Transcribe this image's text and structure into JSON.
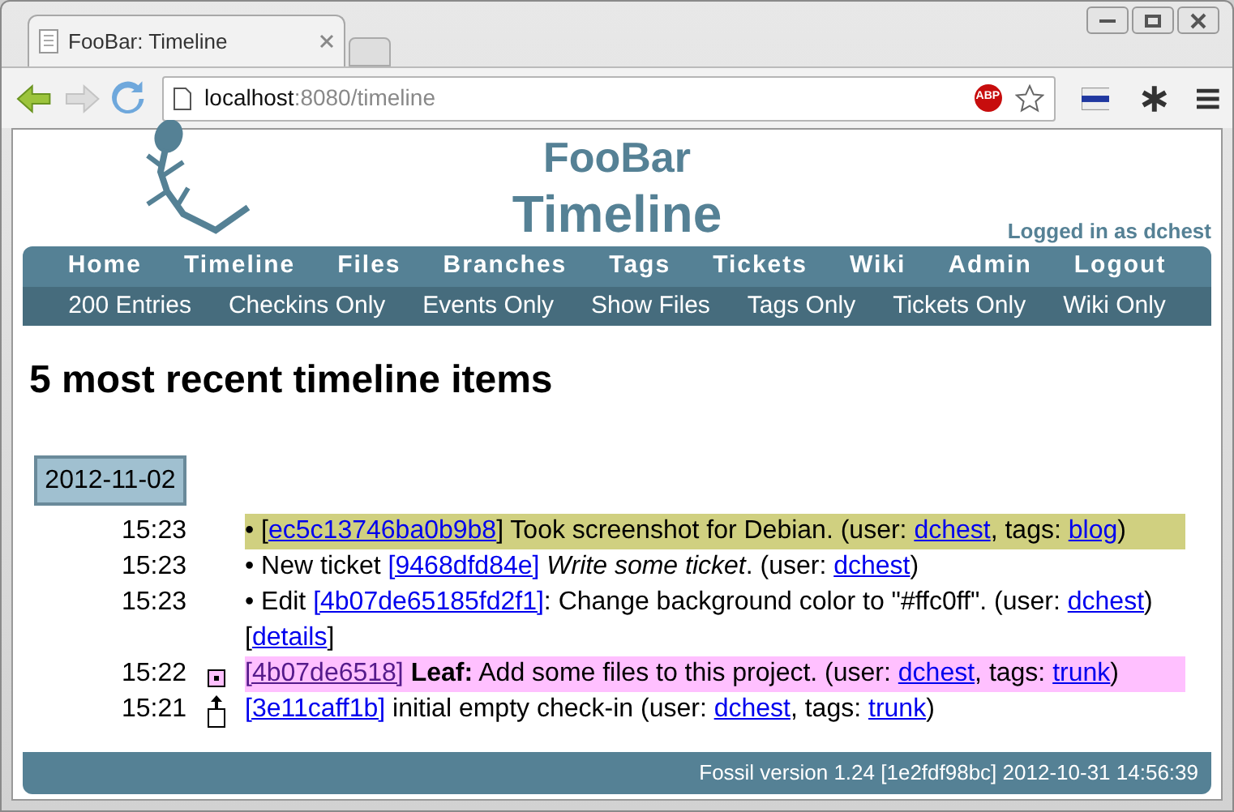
{
  "browser": {
    "tab_title": "FooBar: Timeline",
    "url_host": "localhost",
    "url_rest": ":8080/timeline",
    "adblock": "ABP"
  },
  "header": {
    "project": "FooBar",
    "page_title": "Timeline",
    "login": "Logged in as dchest"
  },
  "main_menu": [
    "Home",
    "Timeline",
    "Files",
    "Branches",
    "Tags",
    "Tickets",
    "Wiki",
    "Admin",
    "Logout"
  ],
  "sub_menu": [
    "200 Entries",
    "Checkins Only",
    "Events Only",
    "Show Files",
    "Tags Only",
    "Tickets Only",
    "Wiki Only"
  ],
  "heading": "5 most recent timeline items",
  "date": "2012-11-02",
  "entries": [
    {
      "time": "15:23",
      "kind": "event",
      "color": "#d0d080",
      "parts": [
        {
          "kind": "text",
          "text": "• ["
        },
        {
          "kind": "link",
          "text": "ec5c13746ba0b9b8"
        },
        {
          "kind": "text",
          "text": "] Took screenshot for Debian. (user: "
        },
        {
          "kind": "link",
          "text": "dchest"
        },
        {
          "kind": "text",
          "text": ", tags: "
        },
        {
          "kind": "link",
          "text": "blog"
        },
        {
          "kind": "text",
          "text": ")"
        }
      ]
    },
    {
      "time": "15:23",
      "kind": "event",
      "parts": [
        {
          "kind": "text",
          "text": "• New ticket "
        },
        {
          "kind": "link",
          "text": "[9468dfd84e]"
        },
        {
          "kind": "text",
          "text": " *Write some ticket*. (user: "
        },
        {
          "kind": "link",
          "text": "dchest"
        },
        {
          "kind": "text",
          "text": ")"
        }
      ]
    },
    {
      "time": "15:23",
      "kind": "event",
      "parts": [
        {
          "kind": "text",
          "text": "• Edit "
        },
        {
          "kind": "link",
          "text": "[4b07de65185fd2f1]"
        },
        {
          "kind": "text",
          "text": ": Change background color to \"#ffc0ff\". (user: "
        },
        {
          "kind": "link",
          "text": "dchest"
        },
        {
          "kind": "text",
          "text": ") ["
        },
        {
          "kind": "link",
          "text": "details"
        },
        {
          "kind": "text",
          "text": "]"
        }
      ]
    },
    {
      "time": "15:22",
      "kind": "leaf",
      "color": "#ffc0ff",
      "parts": [
        {
          "kind": "visited",
          "text": "[4b07de6518]"
        },
        {
          "kind": "text",
          "text": " **Leaf:** Add some files to this project. (user: "
        },
        {
          "kind": "link",
          "text": "dchest"
        },
        {
          "kind": "text",
          "text": ", tags: "
        },
        {
          "kind": "link",
          "text": "trunk"
        },
        {
          "kind": "text",
          "text": ")"
        }
      ]
    },
    {
      "time": "15:21",
      "kind": "checkin",
      "parts": [
        {
          "kind": "link",
          "text": "[3e11caff1b]"
        },
        {
          "kind": "text",
          "text": " initial empty check-in (user: "
        },
        {
          "kind": "link",
          "text": "dchest"
        },
        {
          "kind": "text",
          "text": ", tags: "
        },
        {
          "kind": "link",
          "text": "trunk"
        },
        {
          "kind": "text",
          "text": ")"
        }
      ]
    }
  ],
  "footer": "Fossil version 1.24 [1e2fdf98bc] 2012-10-31 14:56:39"
}
